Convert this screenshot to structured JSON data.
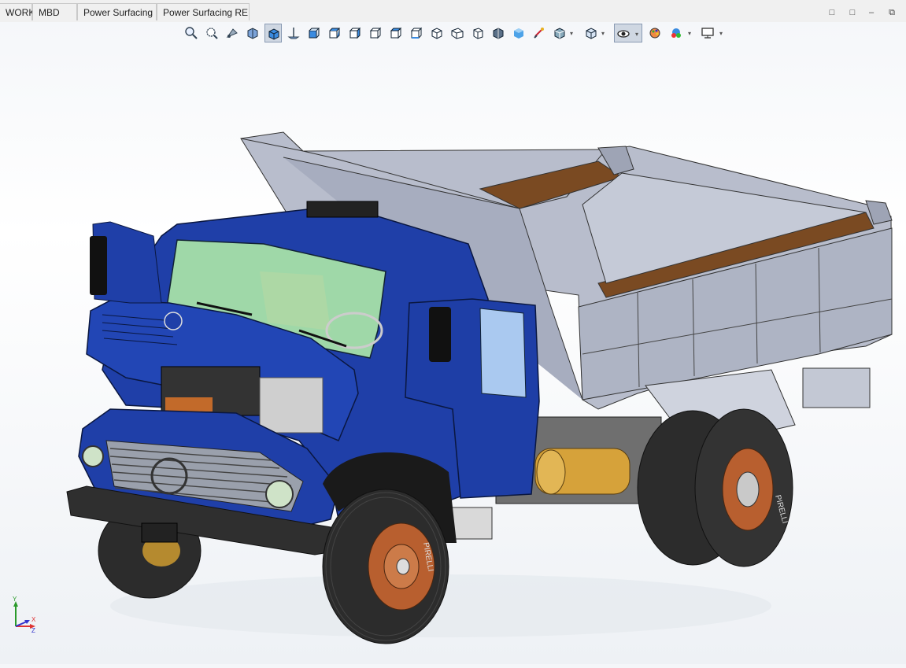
{
  "tabs": [
    "WORKS",
    "MBD",
    "Power Surfacing",
    "Power Surfacing RE"
  ],
  "toolbar": {
    "icons": [
      "zoom-to-fit-icon",
      "zoom-area-icon",
      "previous-view-icon",
      "section-view-icon",
      "view-orientation-icon",
      "normal-to-icon",
      "front-view-icon",
      "back-view-icon",
      "left-view-icon",
      "right-view-icon",
      "top-view-icon",
      "bottom-view-icon",
      "isometric-icon",
      "trimetric-icon",
      "dimetric-icon",
      "shaded-edges-icon",
      "shaded-icon",
      "hidden-lines-icon",
      "display-style-icon",
      "hide-show-icon",
      "appearance-icon",
      "scene-icon",
      "view-settings-icon"
    ]
  },
  "colors": {
    "cab_blue": "#1f3fa8",
    "bed_gray": "#b7bccb",
    "wood": "#7a4a22",
    "wheel_rim": "#b85f2f",
    "tire": "#2c2c2c",
    "tank": "#d6a23a",
    "glass": "#9fd8a8",
    "active_tool": "#cfd7e2"
  },
  "triad": {
    "x": "X",
    "y": "Y",
    "z": "Z"
  }
}
